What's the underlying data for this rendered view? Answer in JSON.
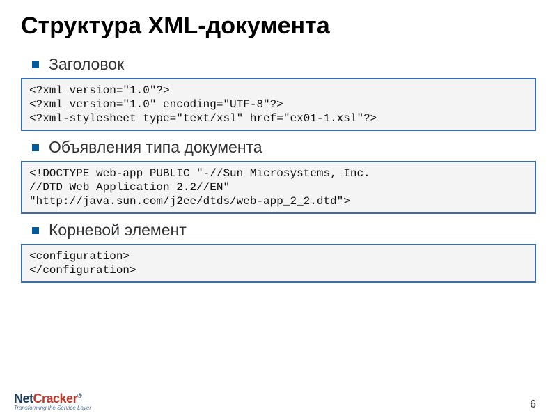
{
  "title": "Структура XML-документа",
  "sections": [
    {
      "label": "Заголовок",
      "code": "<?xml version=\"1.0\"?>\n<?xml version=\"1.0\" encoding=\"UTF-8\"?>\n<?xml-stylesheet type=\"text/xsl\" href=\"ex01-1.xsl\"?>"
    },
    {
      "label": "Объявления типа документа",
      "code": "<!DOCTYPE web-app PUBLIC \"-//Sun Microsystems, Inc.\n//DTD Web Application 2.2//EN\"\n\"http://java.sun.com/j2ee/dtds/web-app_2_2.dtd\">"
    },
    {
      "label": "Корневой элемент",
      "code": "<configuration>\n</configuration>"
    }
  ],
  "logo": {
    "name_prefix": "Net",
    "name_suffix": "Cracker",
    "reg": "®",
    "tagline": "Transforming the Service Layer"
  },
  "page_number": "6"
}
